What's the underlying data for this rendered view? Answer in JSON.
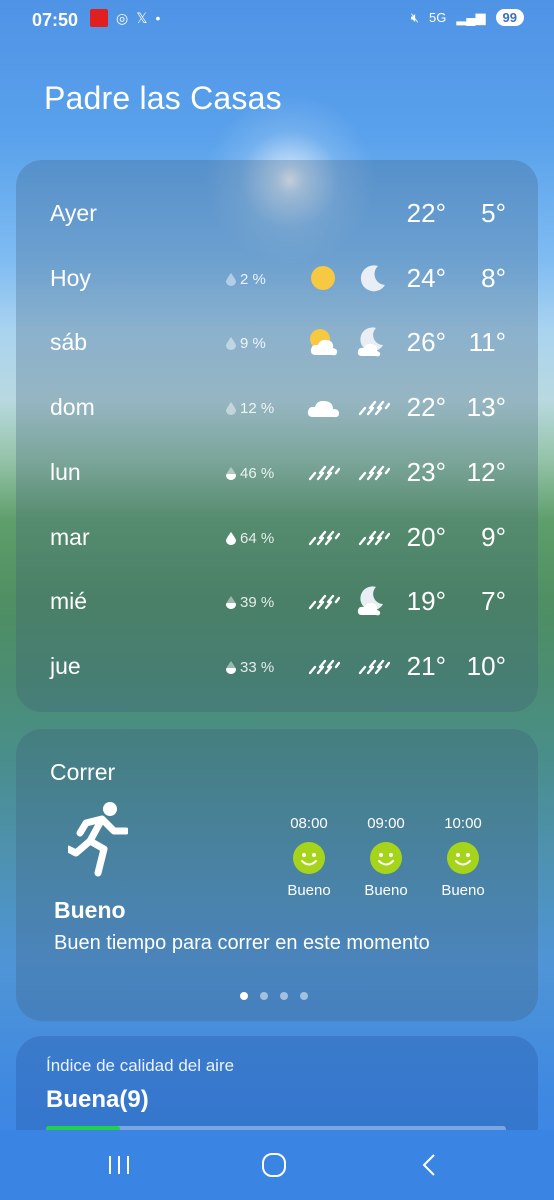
{
  "status_bar": {
    "time": "07:50",
    "network": "5G",
    "battery": "99"
  },
  "city": "Padre las Casas",
  "forecast": [
    {
      "day": "Ayer",
      "precip": "",
      "day_icon": "",
      "night_icon": "",
      "high": "22°",
      "low": "5°"
    },
    {
      "day": "Hoy",
      "precip": "2 %",
      "day_icon": "sun-icon",
      "night_icon": "moon-icon",
      "high": "24°",
      "low": "8°"
    },
    {
      "day": "sáb",
      "precip": "9 %",
      "day_icon": "partly-sunny-icon",
      "night_icon": "partly-cloudy-night-icon",
      "high": "26°",
      "low": "11°"
    },
    {
      "day": "dom",
      "precip": "12 %",
      "day_icon": "cloud-icon",
      "night_icon": "rain-icon",
      "high": "22°",
      "low": "13°"
    },
    {
      "day": "lun",
      "precip": "46 %",
      "day_icon": "rain-icon",
      "night_icon": "rain-icon",
      "high": "23°",
      "low": "12°"
    },
    {
      "day": "mar",
      "precip": "64 %",
      "day_icon": "rain-icon",
      "night_icon": "rain-icon",
      "high": "20°",
      "low": "9°"
    },
    {
      "day": "mié",
      "precip": "39 %",
      "day_icon": "rain-icon",
      "night_icon": "partly-cloudy-night-icon",
      "high": "19°",
      "low": "7°"
    },
    {
      "day": "jue",
      "precip": "33 %",
      "day_icon": "rain-icon",
      "night_icon": "rain-icon",
      "high": "21°",
      "low": "10°"
    }
  ],
  "running": {
    "title": "Correr",
    "status": "Bueno",
    "description": "Buen tiempo para correr en este momento",
    "hours": [
      {
        "time": "08:00",
        "label": "Bueno"
      },
      {
        "time": "09:00",
        "label": "Bueno"
      },
      {
        "time": "10:00",
        "label": "Bueno"
      }
    ]
  },
  "air_quality": {
    "title": "Índice de calidad del aire",
    "value": "Buena(9)",
    "level": 0.16
  },
  "colors": {
    "smile": "#a6d41a",
    "aqi_good": "#22d04a",
    "sun": "#f7c842"
  }
}
